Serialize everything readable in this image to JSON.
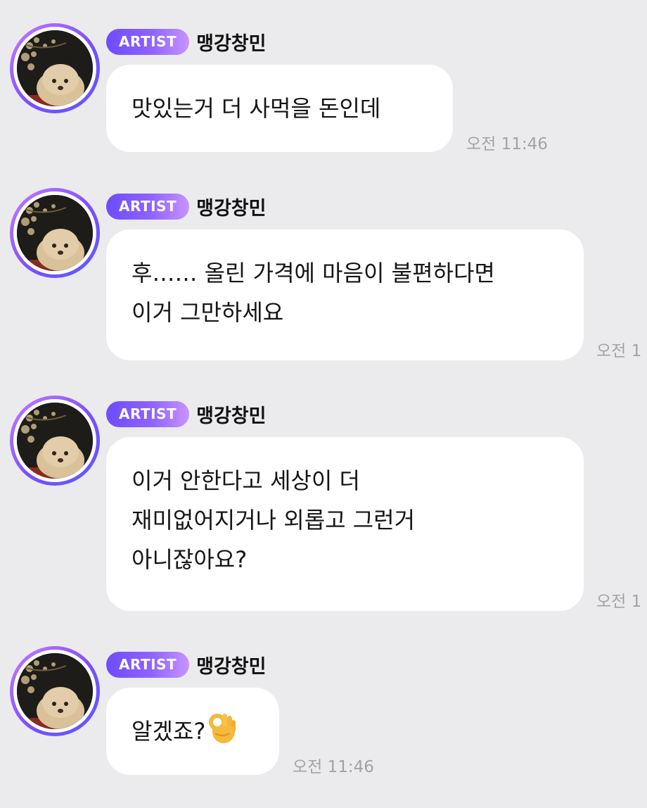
{
  "sender": {
    "badge": "ARTIST",
    "name": "맹강창민"
  },
  "messages": [
    {
      "lines": [
        "맛있는거 더 사먹을 돈인데"
      ],
      "time": "오전 11:46"
    },
    {
      "lines": [
        "후…… 올린 가격에 마음이 불편하다면",
        "이거 그만하세요"
      ],
      "time": "오전 1"
    },
    {
      "lines": [
        "이거 안한다고 세상이 더",
        "재미없어지거나 외롭고 그런거",
        "아니잖아요?"
      ],
      "time": "오전 1"
    },
    {
      "lines": [
        "알겠죠?"
      ],
      "emoji": "ok-hand-emoji",
      "time": "오전 11:46"
    }
  ],
  "colors": {
    "background": "#ebebed",
    "bubble": "#ffffff",
    "badge_start": "#6d4cff",
    "badge_end": "#c893ff",
    "avatar_ring": "#7b4dff",
    "timestamp": "#a3a3a6"
  }
}
